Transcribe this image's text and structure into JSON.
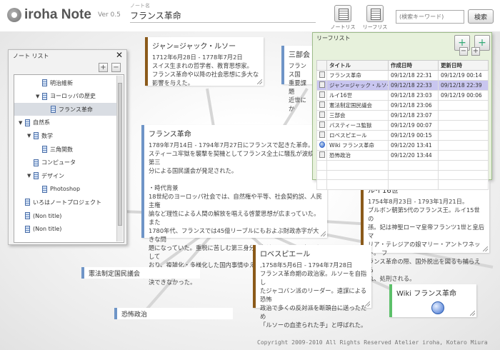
{
  "app": {
    "title": "iroha Note",
    "version": "Ver 0.5"
  },
  "header": {
    "note_name_caption": "ノート名",
    "note_name": "フランス革命",
    "note_list_label": "ノートリスト",
    "leaf_list_label": "リーフリスト",
    "search_placeholder": "(検索キーワード)",
    "search_button": "検索"
  },
  "note_list": {
    "title": "ノート リスト",
    "items": [
      {
        "label": "明治維新",
        "depth": 2,
        "expander": ""
      },
      {
        "label": "ヨーロッパの歴史",
        "depth": 2,
        "expander": "▼"
      },
      {
        "label": "フランス革命",
        "depth": 3,
        "expander": "",
        "selected": true
      },
      {
        "label": "自然系",
        "depth": 0,
        "expander": "▼"
      },
      {
        "label": "数学",
        "depth": 1,
        "expander": "▼"
      },
      {
        "label": "三角関数",
        "depth": 2,
        "expander": ""
      },
      {
        "label": "コンピュータ",
        "depth": 1,
        "expander": ""
      },
      {
        "label": "デザイン",
        "depth": 1,
        "expander": "▼"
      },
      {
        "label": "Photoshop",
        "depth": 2,
        "expander": ""
      },
      {
        "label": "いろはノートプロジェクト",
        "depth": 0,
        "expander": ""
      },
      {
        "label": "(Non title)",
        "depth": 0,
        "expander": ""
      },
      {
        "label": "(Non title)",
        "depth": 0,
        "expander": ""
      }
    ]
  },
  "leaf_list": {
    "title": "リーフリスト",
    "columns": [
      "タイトル",
      "作成日時",
      "更新日時"
    ],
    "rows": [
      {
        "icon": "doc",
        "title": "フランス革命",
        "created": "09/12/18 22:31",
        "updated": "09/12/19 00:14"
      },
      {
        "icon": "doc",
        "title": "ジャン=ジャック・ルソー",
        "created": "09/12/18 22:33",
        "updated": "09/12/18 22:39",
        "selected": true
      },
      {
        "icon": "doc",
        "title": "ルイ16世",
        "created": "09/12/18 23:03",
        "updated": "09/12/19 00:06"
      },
      {
        "icon": "doc",
        "title": "憲法制定国民議会",
        "created": "09/12/18 23:06",
        "updated": ""
      },
      {
        "icon": "doc",
        "title": "三部会",
        "created": "09/12/18 23:07",
        "updated": ""
      },
      {
        "icon": "doc",
        "title": "バスティーユ監獄",
        "created": "09/12/19 00:07",
        "updated": ""
      },
      {
        "icon": "doc",
        "title": "ロベスピエール",
        "created": "09/12/19 00:15",
        "updated": ""
      },
      {
        "icon": "globe",
        "title": "Wiki フランス革命",
        "created": "09/12/20 13:41",
        "updated": ""
      },
      {
        "icon": "doc",
        "title": "恐怖政治",
        "created": "09/12/20 13:44",
        "updated": ""
      }
    ]
  },
  "cards": {
    "rousseau": {
      "title": "ジャン=ジャック・ルソー",
      "body": "1712年6月28日 - 1778年7月2日\nスイス生まれの哲学者、教育思想家。\nフランス革命や以降の社会思想に多大な\n影響を与えた。"
    },
    "sanbukai": {
      "title": "三部会",
      "body": "フランス国\n重要課題\n近世にか"
    },
    "france": {
      "title": "フランス革命",
      "body": "1789年7月14日 - 1794年7月27日にフランスで起きた革命。\nスティーユ牢獄を襲撃を契機としてフランス全土に騒乱が波紋。第三\n分による国民議会が発足された。\n\n・時代背景\n18世紀のヨーロッパ社会では、自然権や平等、社会契約説、人民主権\n論など理性による人間の解放を唱える啓蒙思想が広まっていた。また\n1780年代、フランスでは45億リーブルにもおよぶ財政赤字が大きな問\n題になっていた。重税に苦しむ第三身分の経済はすでに頂点に達して\nおり、複雑化・多様化した国内事情ゆえ、従来の身分制では問題を解\n決できなかった。"
    },
    "louis": {
      "title": "ルイ16世",
      "body": "1754年8月23日 - 1793年1月21日。\nブルボン朝第5代のフランス王。ルイ15世の\n孫。妃は神聖ローマ皇帝フランツ1世と皇后マ\nリア・テレジアの娘マリー・アントワネット。 フ\nランス革命の際、国外脱出を図るも捕らえら\nれ、処刑される。"
    },
    "robespierre": {
      "title": "ロベスピエール",
      "body": ",1758年5月6日 - 1794年7月28日\nフランス革命期の政治家。ルソーを自指し\nたジャコバン派のリーダー。遠謀による恐怖\n政治で多くの反対派を断頭台に送ったため\n「ルソーの血塗られた手」と呼ばれた。"
    },
    "kenpou": {
      "title": "憲法制定国民議会"
    },
    "kyoufu": {
      "title": "恐怖政治"
    },
    "wiki": {
      "title": "Wiki フランス革命"
    }
  },
  "footer": "Copyright 2009-2010 All Rights Reserved Atelier iroha, Kotaro Miura",
  "colors": {
    "blue_tag": "#6f95c7",
    "brown_tag": "#8b5a1a",
    "green_tag": "#5cc06a",
    "leaf_panel": "#e7f1dc"
  }
}
